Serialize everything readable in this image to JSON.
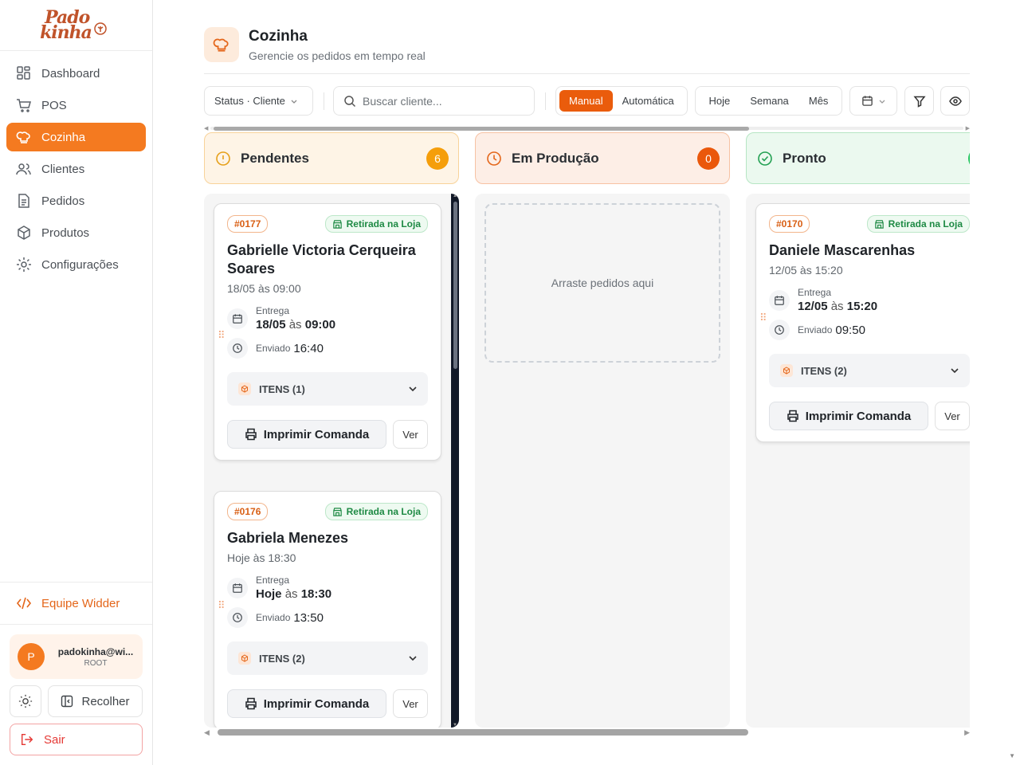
{
  "brand": {
    "logo_line1": "Pado",
    "logo_line2": "kinha"
  },
  "sidebar": {
    "items": [
      {
        "label": "Dashboard",
        "icon": "dashboard-icon"
      },
      {
        "label": "POS",
        "icon": "cart-icon"
      },
      {
        "label": "Cozinha",
        "icon": "chef-hat-icon",
        "active": true
      },
      {
        "label": "Clientes",
        "icon": "users-icon"
      },
      {
        "label": "Pedidos",
        "icon": "document-icon"
      },
      {
        "label": "Produtos",
        "icon": "package-icon"
      },
      {
        "label": "Configurações",
        "icon": "gear-icon"
      }
    ],
    "team_link": "Equipe Widder",
    "user": {
      "initial": "P",
      "email": "padokinha@wi...",
      "role": "ROOT"
    },
    "collapse_label": "Recolher",
    "logout_label": "Sair"
  },
  "page": {
    "title": "Cozinha",
    "subtitle": "Gerencie os pedidos em tempo real"
  },
  "toolbar": {
    "filter_label": "Status · Cliente",
    "search_placeholder": "Buscar cliente...",
    "modes": [
      "Manual",
      "Automática"
    ],
    "active_mode": "Manual",
    "periods": [
      "Hoje",
      "Semana",
      "Mês"
    ]
  },
  "columns": [
    {
      "title": "Pendentes",
      "count": "6",
      "icon": "alert-circle-icon",
      "colors": {
        "bg": "#fef4e6",
        "border": "#f8d39a",
        "badge": "#f59e0b",
        "icon": "#e6a01a"
      },
      "cards": [
        {
          "number": "#0177",
          "type": "Retirada na Loja",
          "customer": "Gabrielle Victoria Cerqueira Soares",
          "scheduled": "18/05 às 09:00",
          "delivery_label": "Entrega",
          "delivery_date": "18/05",
          "delivery_at": "às",
          "delivery_time": "09:00",
          "sent_label": "Enviado",
          "sent_time": "16:40",
          "items_label": "ITENS (1)",
          "print_label": "Imprimir Comanda",
          "view_label": "Ver"
        },
        {
          "number": "#0176",
          "type": "Retirada na Loja",
          "customer": "Gabriela Menezes",
          "scheduled": "Hoje às 18:30",
          "delivery_label": "Entrega",
          "delivery_date": "Hoje",
          "delivery_at": "às",
          "delivery_time": "18:30",
          "sent_label": "Enviado",
          "sent_time": "13:50",
          "items_label": "ITENS (2)",
          "print_label": "Imprimir Comanda",
          "view_label": "Ver"
        }
      ]
    },
    {
      "title": "Em Produção",
      "count": "0",
      "icon": "clock-icon",
      "colors": {
        "bg": "#fdeee6",
        "border": "#f7c2a3",
        "badge": "#ea580c",
        "icon": "#e4661a"
      },
      "empty_text": "Arraste pedidos aqui"
    },
    {
      "title": "Pronto",
      "count": "",
      "icon": "check-circle-icon",
      "colors": {
        "bg": "#ebf9ef",
        "border": "#b6e6c4",
        "badge": "#22c55e",
        "icon": "#22a052"
      },
      "cards": [
        {
          "number": "#0170",
          "type": "Retirada na Loja",
          "customer": "Daniele Mascarenhas",
          "scheduled": "12/05 às 15:20",
          "delivery_label": "Entrega",
          "delivery_date": "12/05",
          "delivery_at": "às",
          "delivery_time": "15:20",
          "sent_label": "Enviado",
          "sent_time": "09:50",
          "items_label": "ITENS (2)",
          "print_label": "Imprimir Comanda",
          "view_label": "Ver"
        }
      ]
    }
  ]
}
